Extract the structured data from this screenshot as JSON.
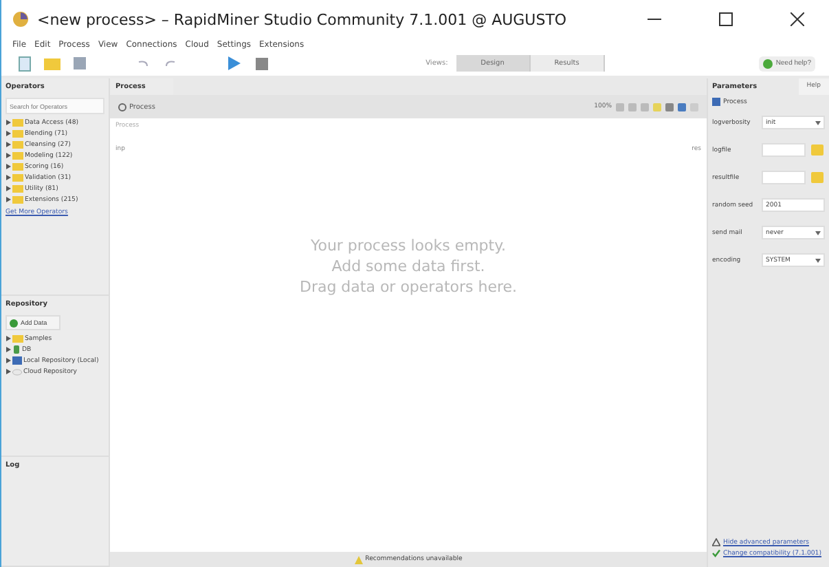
{
  "window": {
    "title": "<new process> – RapidMiner Studio Community 7.1.001 @ AUGUSTO"
  },
  "menu": [
    "File",
    "Edit",
    "Process",
    "View",
    "Connections",
    "Cloud",
    "Settings",
    "Extensions"
  ],
  "toolbar": {
    "views_label": "Views:",
    "views": [
      {
        "label": "Design",
        "selected": true
      },
      {
        "label": "Results",
        "selected": false
      }
    ],
    "help": "Need help?"
  },
  "operators": {
    "title": "Operators",
    "search": {
      "placeholder": "Search for Operators"
    },
    "items": [
      {
        "label": "Data Access (48)",
        "expanded": false
      },
      {
        "label": "Blending (71)",
        "expanded": false
      },
      {
        "label": "Cleansing (27)",
        "expanded": false
      },
      {
        "label": "Modeling (122)",
        "expanded": false
      },
      {
        "label": "Scoring (16)",
        "expanded": false
      },
      {
        "label": "Validation (31)",
        "expanded": false
      },
      {
        "label": "Utility (81)",
        "expanded": false
      },
      {
        "label": "Extensions (215)",
        "expanded": false
      }
    ],
    "link": "Get More Operators"
  },
  "repository": {
    "title": "Repository",
    "add_data": "Add Data",
    "items": [
      {
        "label": "Samples",
        "kind": "folder",
        "expanded": false
      },
      {
        "label": "DB",
        "kind": "db",
        "expanded": false
      },
      {
        "label": "Local Repository (Local)",
        "kind": "local",
        "expanded": false
      },
      {
        "label": "Cloud Repository",
        "kind": "cloud",
        "expanded": false
      }
    ]
  },
  "log": {
    "title": "Log"
  },
  "process": {
    "tab": "Process",
    "breadcrumb": "Process",
    "zoom": "100%",
    "canvas_label": "Process",
    "port_in": "inp",
    "port_out": "res",
    "empty_lines": [
      "Your process looks empty.",
      "Add some data first.",
      "Drag data or operators here."
    ],
    "footer": "Recommendations unavailable"
  },
  "parameters": {
    "tab": "Parameters",
    "help_tab": "Help",
    "header": "Process",
    "params": [
      {
        "label": "logverbosity",
        "kind": "select",
        "value": "init"
      },
      {
        "label": "logfile",
        "kind": "file"
      },
      {
        "label": "resultfile",
        "kind": "file"
      },
      {
        "label": "random seed",
        "kind": "text",
        "value": "2001"
      },
      {
        "label": "send mail",
        "kind": "select",
        "value": "never"
      },
      {
        "label": "encoding",
        "kind": "select",
        "value": "SYSTEM"
      }
    ],
    "links": [
      {
        "label": "Hide advanced parameters",
        "kind": "warn"
      },
      {
        "label": "Change compatibility (7.1.001)",
        "kind": "check"
      }
    ]
  }
}
